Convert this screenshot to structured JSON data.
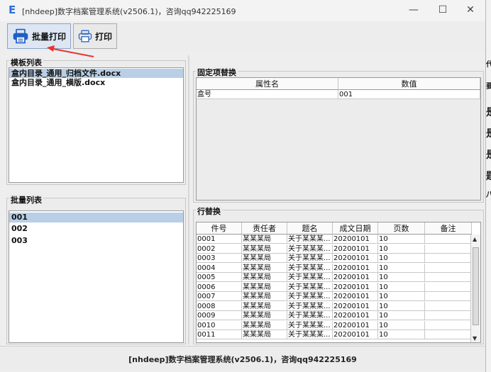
{
  "window": {
    "title": "[nhdeep]数字档案管理系统(v2506.1)，咨询qq942225169",
    "app_icon": "E",
    "minimize": "—",
    "maximize": "☐",
    "close": "✕"
  },
  "toolbar": {
    "batch_print_label": "批量打印",
    "print_label": "打印"
  },
  "template_list": {
    "title": "模板列表",
    "items": [
      "盒内目录_通用_归档文件.docx",
      "盒内目录_通用_横版.docx"
    ],
    "selected_index": 0
  },
  "batch_list": {
    "title": "批量列表",
    "items": [
      "001",
      "002",
      "003"
    ],
    "selected_index": 0
  },
  "fixed_replace": {
    "title": "固定项替换",
    "columns": [
      "属性名",
      "数值"
    ],
    "rows": [
      [
        "盒号",
        "001"
      ]
    ]
  },
  "row_replace": {
    "title": "行替换",
    "columns": [
      "件号",
      "责任者",
      "题名",
      "成文日期",
      "页数",
      "备注"
    ],
    "rows": [
      [
        "0001",
        "某某某局",
        "关于某某某...",
        "20200101",
        "10",
        ""
      ],
      [
        "0002",
        "某某某局",
        "关于某某某...",
        "20200101",
        "10",
        ""
      ],
      [
        "0003",
        "某某某局",
        "关于某某某...",
        "20200101",
        "10",
        ""
      ],
      [
        "0004",
        "某某某局",
        "关于某某某...",
        "20200101",
        "10",
        ""
      ],
      [
        "0005",
        "某某某局",
        "关于某某某...",
        "20200101",
        "10",
        ""
      ],
      [
        "0006",
        "某某某局",
        "关于某某某...",
        "20200101",
        "10",
        ""
      ],
      [
        "0007",
        "某某某局",
        "关于某某某...",
        "20200101",
        "10",
        ""
      ],
      [
        "0008",
        "某某某局",
        "关于某某某...",
        "20200101",
        "10",
        ""
      ],
      [
        "0009",
        "某某某局",
        "关于某某某...",
        "20200101",
        "10",
        ""
      ],
      [
        "0010",
        "某某某局",
        "关于某某某...",
        "20200101",
        "10",
        ""
      ],
      [
        "0011",
        "某某某局",
        "关于某某某...",
        "20200101",
        "10",
        ""
      ]
    ]
  },
  "status": {
    "text": "[nhdeep]数字档案管理系统(v2506.1)，咨询qq942225169"
  },
  "background_edge": [
    "代",
    "要",
    "是",
    "是",
    "是",
    "题",
    "八"
  ],
  "colors": {
    "selection": "#b8cfe6",
    "arrow": "#e8332f",
    "icon_blue": "#1f5fc4"
  }
}
